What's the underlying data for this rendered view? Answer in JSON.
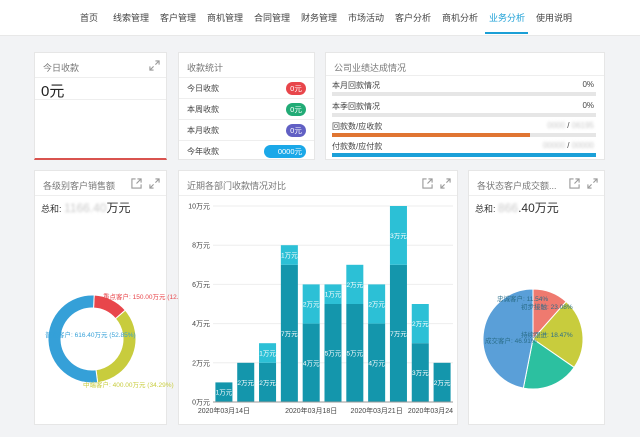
{
  "nav": {
    "items": [
      "首页",
      "线索管理",
      "客户管理",
      "商机管理",
      "合同管理",
      "财务管理",
      "市场活动",
      "客户分析",
      "商机分析",
      "业务分析",
      "使用说明"
    ],
    "active_index": 9
  },
  "today": {
    "title": "今日收款",
    "value": "0元"
  },
  "collection": {
    "title": "收款统计",
    "rows": [
      {
        "label": "今日收款",
        "badge": "0元",
        "color": "#e8464b"
      },
      {
        "label": "本周收款",
        "badge": "0元",
        "color": "#22ab76"
      },
      {
        "label": "本月收款",
        "badge": "0元",
        "color": "#6160c4"
      },
      {
        "label": "今年收款",
        "badge": "0000元",
        "color": "#1ba8e8"
      }
    ]
  },
  "performance": {
    "title": "公司业绩达成情况",
    "rows": [
      {
        "label": "本月回款情况",
        "value": "0%",
        "fraction": 0,
        "color": "#e07532"
      },
      {
        "label": "本季回款情况",
        "value": "0%",
        "fraction": 0,
        "color": "#e07532"
      },
      {
        "label": "回款数/应收款",
        "value_a": "0000",
        "value_b": "06195",
        "fraction": 0.75,
        "color": "#e07532"
      },
      {
        "label": "付款数/应付款",
        "value_a": "00000",
        "value_b": "00000",
        "fraction": 1.0,
        "color": "#1ba0d8"
      }
    ]
  },
  "level_sales": {
    "title": "各级别客户销售额",
    "total_label": "总和:",
    "total_blur": "1166.40",
    "total_unit": "万元",
    "chart_data": {
      "type": "pie",
      "donut": true,
      "slices": [
        {
          "label": "重点客户: 150.00万元 (12.86%)",
          "value": 150.0,
          "color": "#e8464b"
        },
        {
          "label": "中端客户: 400.00万元 (34.29%)",
          "value": 400.0,
          "color": "#c8cc3d"
        },
        {
          "label": "普通客户: 616.40万元 (52.85%)",
          "value": 616.4,
          "color": "#35a0d8"
        }
      ]
    }
  },
  "dept_collection": {
    "title": "近期各部门收款情况对比",
    "chart_data": {
      "type": "bar",
      "stacked": true,
      "y_ticks": [
        "0万元",
        "2万元",
        "4万元",
        "6万元",
        "8万元",
        "10万元"
      ],
      "ylim": [
        0,
        10
      ],
      "x_tick_labels": [
        "2020年03月14日",
        "2020年03月18日",
        "2020年03月21日",
        "2020年03月24"
      ],
      "x_tick_at": [
        0,
        4,
        7,
        10
      ],
      "series": [
        {
          "values": [
            1,
            2,
            2,
            7,
            4,
            5,
            5,
            4,
            7,
            3,
            2
          ],
          "color": "#1496ac",
          "labels": [
            "1万元",
            "2万元",
            "2万元",
            "7万元",
            "4万元",
            "5万元",
            "5万元",
            "4万元",
            "7万元",
            "3万元",
            "2万元"
          ]
        },
        {
          "values": [
            0,
            0,
            1,
            1,
            2,
            1,
            2,
            2,
            3,
            2,
            0
          ],
          "color": "#2cc0d6",
          "labels": [
            "",
            "",
            "1万元",
            "1万元",
            "2万元",
            "1万元",
            "2万元",
            "2万元",
            "3万元",
            "2万元",
            ""
          ]
        }
      ]
    }
  },
  "status_deals": {
    "title": "各状态客户成交额...",
    "total_label": "总和:",
    "total_blur": "866",
    "total_suffix": ".40万元",
    "chart_data": {
      "type": "pie",
      "slices": [
        {
          "label": "忠诚客户: 11.54%",
          "value": 11.54,
          "color": "#ef7a6f"
        },
        {
          "label": "初步接触: 23.08%",
          "value": 23.08,
          "color": "#c8cc3d"
        },
        {
          "label": "持续跟进: 18.47%",
          "value": 18.47,
          "color": "#2cc0a0"
        },
        {
          "label": "成交客户: 46.91%",
          "value": 46.91,
          "color": "#5a9fd8"
        }
      ]
    }
  }
}
